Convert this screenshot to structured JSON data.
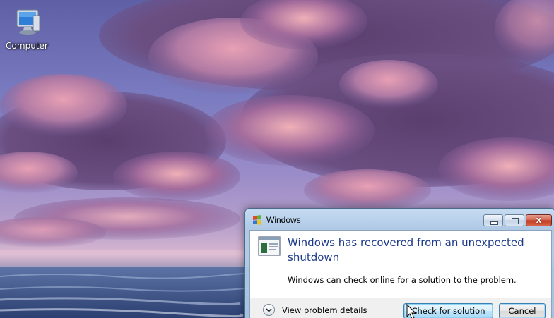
{
  "desktop": {
    "icons": [
      {
        "label": "Computer",
        "icon": "computer-icon"
      }
    ]
  },
  "dialog": {
    "title": "Windows",
    "title_icon": "windows-flag-icon",
    "heading": "Windows has recovered from an unexpected shutdown",
    "body": "Windows can check online for a solution to the problem.",
    "details_toggle_label": "View problem details",
    "buttons": {
      "check": "Check for solution",
      "cancel": "Cancel"
    },
    "caption_buttons": {
      "close": "x"
    }
  },
  "colors": {
    "heading": "#1e3a8a",
    "accent_button_border": "#3c7fb1",
    "close_button": "#c2391f"
  }
}
